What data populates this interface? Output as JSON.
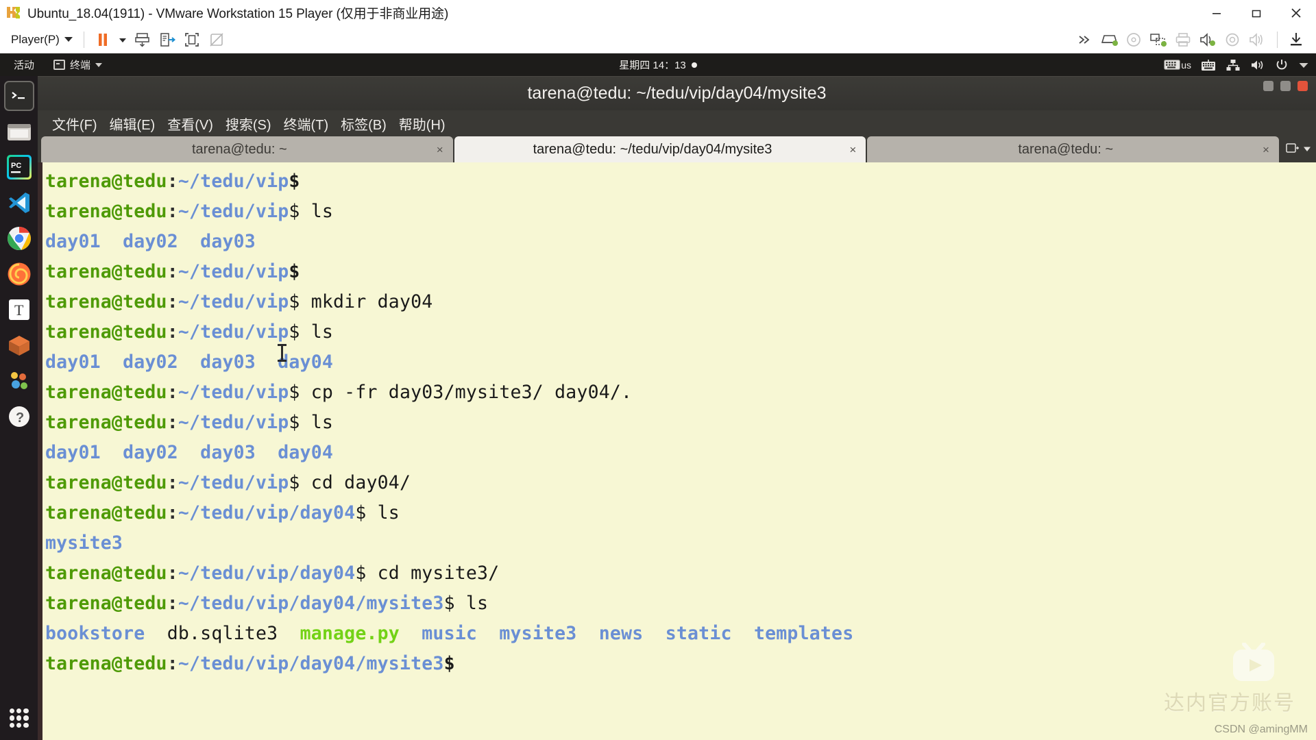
{
  "vmware": {
    "title": "Ubuntu_18.04(1911) - VMware Workstation 15 Player (仅用于非商业用途)",
    "logo_icon": "vmware-logo-icon",
    "window_buttons": [
      {
        "name": "minimize-button",
        "icon": "minimize-icon"
      },
      {
        "name": "restore-button",
        "icon": "restore-icon"
      },
      {
        "name": "close-button",
        "icon": "close-icon"
      }
    ],
    "toolbar": {
      "player_menu_label": "Player(P)",
      "left_icons": [
        {
          "name": "pause-button",
          "icon": "pause-icon"
        },
        {
          "name": "pause-dropdown",
          "icon": "chevron-down-icon"
        },
        {
          "name": "send-ctrl-alt-del-button",
          "icon": "send-key-icon"
        },
        {
          "name": "manage-button",
          "icon": "transfer-icon"
        },
        {
          "name": "full-screen-button",
          "icon": "fullscreen-icon"
        },
        {
          "name": "unity-mode-button",
          "icon": "unity-mode-icon"
        }
      ],
      "right_icons": [
        {
          "name": "more-devices-button",
          "icon": "chevrons-right-icon"
        },
        {
          "name": "hard-disk-device-button",
          "icon": "hard-disk-icon"
        },
        {
          "name": "cd-dvd-device-button",
          "icon": "cd-dvd-icon"
        },
        {
          "name": "network-adapter-button",
          "icon": "network-adapter-icon"
        },
        {
          "name": "printer-device-button",
          "icon": "printer-icon"
        },
        {
          "name": "sound-card-button",
          "icon": "sound-card-icon"
        },
        {
          "name": "camera-device-button",
          "icon": "camera-icon"
        },
        {
          "name": "speaker-device-button",
          "icon": "speaker-icon"
        },
        {
          "name": "install-tools-button",
          "icon": "download-icon"
        }
      ]
    }
  },
  "gnome_panel": {
    "activities_label": "活动",
    "app_menu_label": "终端",
    "app_icon": "terminal-icon",
    "clock": "星期四 14：13",
    "clock_dot": "●",
    "indicators": [
      {
        "name": "keyboard-layout-indicator",
        "label": "us",
        "icon": "keyboard-icon"
      },
      {
        "name": "on-screen-keyboard-indicator",
        "label": "",
        "icon": "onscreen-keyboard-icon"
      },
      {
        "name": "network-indicator",
        "label": "",
        "icon": "network-icon"
      },
      {
        "name": "volume-indicator",
        "label": "",
        "icon": "volume-icon"
      },
      {
        "name": "power-indicator",
        "label": "",
        "icon": "power-icon"
      },
      {
        "name": "system-menu-caret",
        "label": "",
        "icon": "chevron-down-icon"
      }
    ]
  },
  "launcher": {
    "items": [
      {
        "name": "launcher-item-terminal",
        "icon": "terminal-icon",
        "color": "#2c2c2c"
      },
      {
        "name": "launcher-item-files",
        "icon": "files-icon",
        "color": "#e8e6e3"
      },
      {
        "name": "launcher-item-pycharm",
        "icon": "pycharm-icon",
        "color": "#21d789"
      },
      {
        "name": "launcher-item-vscode",
        "icon": "vscode-icon",
        "color": "#2395d6"
      },
      {
        "name": "launcher-item-chrome",
        "icon": "chrome-icon",
        "color": "#4285f4"
      },
      {
        "name": "launcher-item-firefox",
        "icon": "firefox-icon",
        "color": "#ff7139"
      },
      {
        "name": "launcher-item-text-editor",
        "icon": "text-editor-icon",
        "color": "#ffffff"
      },
      {
        "name": "launcher-item-software",
        "icon": "ubuntu-software-icon",
        "color": "#e0732c"
      },
      {
        "name": "launcher-item-help",
        "icon": "help-icon",
        "color": "#dd4814"
      },
      {
        "name": "launcher-item-amazon",
        "icon": "amazon-icon",
        "color": "#f7b733"
      },
      {
        "name": "launcher-item-help-circle",
        "icon": "help-circle-icon",
        "color": "#ffffff"
      }
    ],
    "show_apps": {
      "name": "show-applications-button",
      "icon": "grid-dots-icon"
    }
  },
  "terminal": {
    "window_title": "tarena@tedu: ~/tedu/vip/day04/mysite3",
    "window_buttons": [
      {
        "name": "terminal-minimize-button",
        "icon": "minimize-icon"
      },
      {
        "name": "terminal-maximize-button",
        "icon": "maximize-icon"
      },
      {
        "name": "terminal-close-button",
        "icon": "close-icon"
      }
    ],
    "menu": [
      "文件(F)",
      "编辑(E)",
      "查看(V)",
      "搜索(S)",
      "终端(T)",
      "标签(B)",
      "帮助(H)"
    ],
    "tabs": [
      {
        "label": "tarena@tedu: ~",
        "active": false,
        "close": "×"
      },
      {
        "label": "tarena@tedu: ~/tedu/vip/day04/mysite3",
        "active": true,
        "close": "×"
      },
      {
        "label": "tarena@tedu: ~",
        "active": false,
        "close": "×"
      }
    ],
    "tabbar_right": [
      {
        "name": "new-tab-button",
        "icon": "new-tab-icon"
      },
      {
        "name": "tab-list-button",
        "icon": "chevron-down-icon"
      }
    ],
    "colors": {
      "background": "#f7f7d4",
      "user_green": "#4e9a06",
      "path_blue": "#6a8fd4",
      "text_black": "#1a1a1a",
      "exec_green": "#73d216"
    },
    "lines": [
      [
        {
          "t": "tarena@tedu",
          "c": "user"
        },
        {
          "t": ":",
          "c": "colon"
        },
        {
          "t": "~/tedu/vip",
          "c": "path"
        },
        {
          "t": "$",
          "c": "prompt"
        }
      ],
      [
        {
          "t": "tarena@tedu",
          "c": "user"
        },
        {
          "t": ":",
          "c": "colon"
        },
        {
          "t": "~/tedu/vip",
          "c": "path"
        },
        {
          "t": "$ ls",
          "c": "cmd"
        }
      ],
      [
        {
          "t": "day01  day02  day03",
          "c": "dir"
        }
      ],
      [
        {
          "t": "tarena@tedu",
          "c": "user"
        },
        {
          "t": ":",
          "c": "colon"
        },
        {
          "t": "~/tedu/vip",
          "c": "path"
        },
        {
          "t": "$",
          "c": "prompt"
        }
      ],
      [
        {
          "t": "tarena@tedu",
          "c": "user"
        },
        {
          "t": ":",
          "c": "colon"
        },
        {
          "t": "~/tedu/vip",
          "c": "path"
        },
        {
          "t": "$ mkdir day04",
          "c": "cmd"
        }
      ],
      [
        {
          "t": "tarena@tedu",
          "c": "user"
        },
        {
          "t": ":",
          "c": "colon"
        },
        {
          "t": "~/tedu/vip",
          "c": "path"
        },
        {
          "t": "$ ls",
          "c": "cmd"
        }
      ],
      [
        {
          "t": "day01  day02  day03  day04",
          "c": "dir"
        }
      ],
      [
        {
          "t": "tarena@tedu",
          "c": "user"
        },
        {
          "t": ":",
          "c": "colon"
        },
        {
          "t": "~/tedu/vip",
          "c": "path"
        },
        {
          "t": "$ cp -fr day03/mysite3/ day04/.",
          "c": "cmd"
        }
      ],
      [
        {
          "t": "tarena@tedu",
          "c": "user"
        },
        {
          "t": ":",
          "c": "colon"
        },
        {
          "t": "~/tedu/vip",
          "c": "path"
        },
        {
          "t": "$ ls",
          "c": "cmd"
        }
      ],
      [
        {
          "t": "day01  day02  day03  day04",
          "c": "dir"
        }
      ],
      [
        {
          "t": "tarena@tedu",
          "c": "user"
        },
        {
          "t": ":",
          "c": "colon"
        },
        {
          "t": "~/tedu/vip",
          "c": "path"
        },
        {
          "t": "$ cd day04/",
          "c": "cmd"
        }
      ],
      [
        {
          "t": "tarena@tedu",
          "c": "user"
        },
        {
          "t": ":",
          "c": "colon"
        },
        {
          "t": "~/tedu/vip/day04",
          "c": "path"
        },
        {
          "t": "$ ls",
          "c": "cmd"
        }
      ],
      [
        {
          "t": "mysite3",
          "c": "dir"
        }
      ],
      [
        {
          "t": "tarena@tedu",
          "c": "user"
        },
        {
          "t": ":",
          "c": "colon"
        },
        {
          "t": "~/tedu/vip/day04",
          "c": "path"
        },
        {
          "t": "$ cd mysite3/",
          "c": "cmd"
        }
      ],
      [
        {
          "t": "tarena@tedu",
          "c": "user"
        },
        {
          "t": ":",
          "c": "colon"
        },
        {
          "t": "~/tedu/vip/day04/mysite3",
          "c": "path"
        },
        {
          "t": "$ ls",
          "c": "cmd"
        }
      ],
      [
        {
          "t": "bookstore",
          "c": "dir"
        },
        {
          "t": "  ",
          "c": "file"
        },
        {
          "t": "db.sqlite3",
          "c": "file"
        },
        {
          "t": "  ",
          "c": "file"
        },
        {
          "t": "manage.py",
          "c": "exec"
        },
        {
          "t": "  ",
          "c": "file"
        },
        {
          "t": "music",
          "c": "dir"
        },
        {
          "t": "  ",
          "c": "file"
        },
        {
          "t": "mysite3",
          "c": "dir"
        },
        {
          "t": "  ",
          "c": "file"
        },
        {
          "t": "news",
          "c": "dir"
        },
        {
          "t": "  ",
          "c": "file"
        },
        {
          "t": "static",
          "c": "dir"
        },
        {
          "t": "  ",
          "c": "file"
        },
        {
          "t": "templates",
          "c": "dir"
        }
      ],
      [
        {
          "t": "tarena@tedu",
          "c": "user"
        },
        {
          "t": ":",
          "c": "colon"
        },
        {
          "t": "~/tedu/vip/day04/mysite3",
          "c": "path"
        },
        {
          "t": "$",
          "c": "prompt"
        }
      ]
    ]
  },
  "watermarks": {
    "bilibili_icon": "bilibili-logo-icon",
    "channel": "达内官方账号",
    "csdn": "CSDN @amingMM"
  }
}
